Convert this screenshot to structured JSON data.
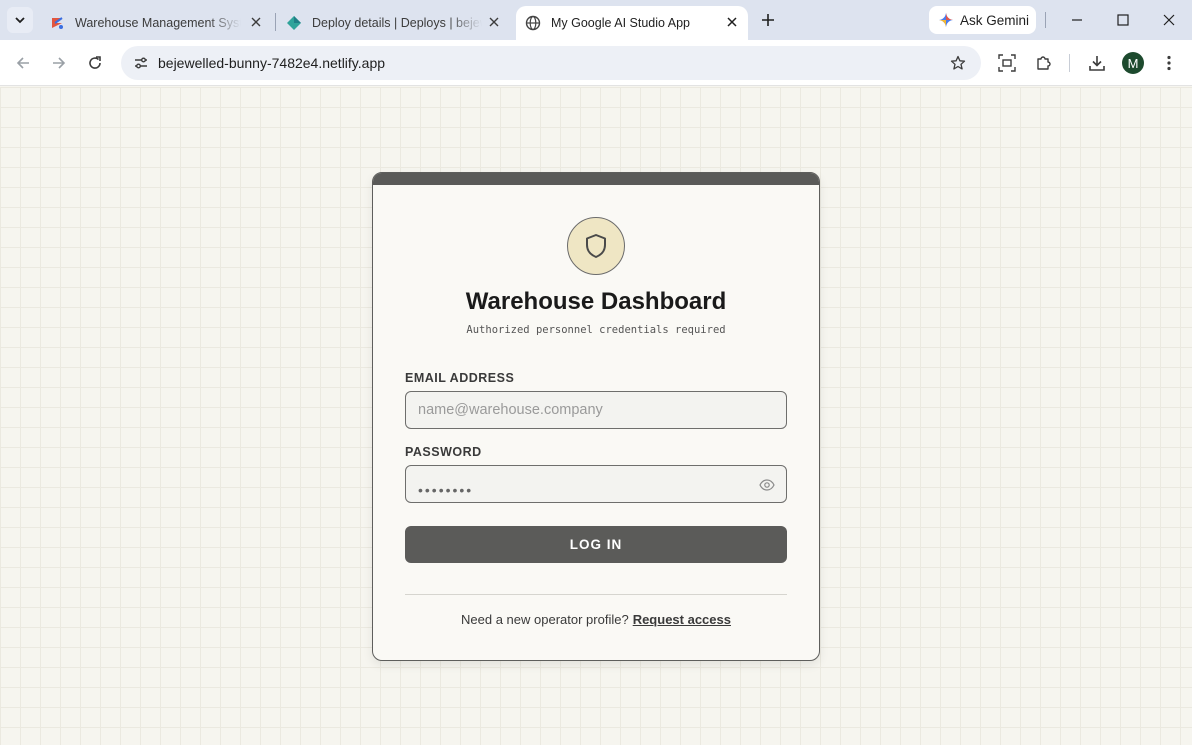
{
  "browser": {
    "tabs": [
      {
        "title": "Warehouse Management Syste",
        "icon": "warehouse-favicon-icon",
        "active": false
      },
      {
        "title": "Deploy details | Deploys | bejew",
        "icon": "netlify-favicon-icon",
        "active": false
      },
      {
        "title": "My Google AI Studio App",
        "icon": "globe-favicon-icon",
        "active": true
      }
    ],
    "ask_gemini_label": "Ask Gemini",
    "url": "bejewelled-bunny-7482e4.netlify.app",
    "profile_initial": "M",
    "colors": {
      "tabstrip": "#dde3ef",
      "omnibox": "#edf0f6",
      "avatar": "#1d4a2e"
    }
  },
  "login": {
    "title": "Warehouse Dashboard",
    "subtitle": "Authorized personnel credentials required",
    "email_label": "EMAIL ADDRESS",
    "email_placeholder": "name@warehouse.company",
    "password_label": "PASSWORD",
    "password_masked": "••••••••",
    "login_button": "LOG IN",
    "footer_text": "Need a new operator profile?",
    "footer_link": "Request access",
    "colors": {
      "accent": "#5a5a58",
      "shield_bg": "#efe6c4",
      "card_bg": "#faf9f5"
    }
  }
}
